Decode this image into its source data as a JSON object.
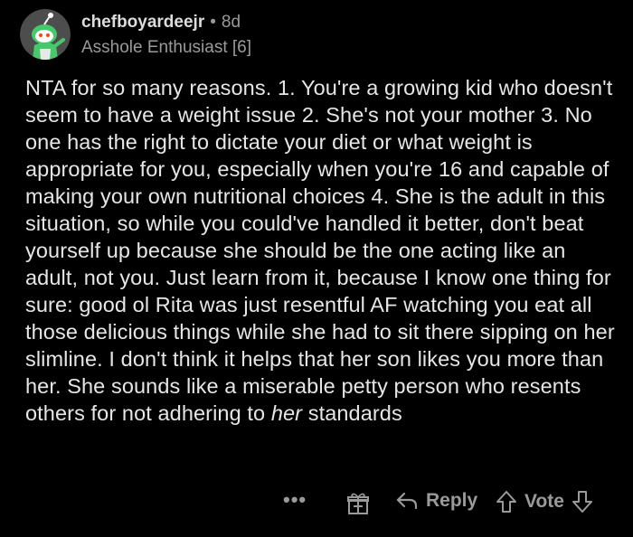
{
  "comment": {
    "username": "chefboyardeejr",
    "separator": "•",
    "age": "8d",
    "flair": "Asshole Enthusiast [6]",
    "text_before_italic": "NTA for so many reasons. 1. You're a growing kid who doesn't seem to have a weight issue 2. She's not your mother 3. No one has the right to dictate your diet or what weight is appropriate for you, especially when you're 16 and capable of making your own nutritional choices 4. She is the adult in this situation, so while you could've handled it better, don't beat yourself up because she should be the one acting like an adult, not you. Just learn from it, because I know one thing for sure: good ol Rita was just resentful AF watching you eat all those delicious things while she had to sit there sipping on her slimline. I don't think it helps that her son likes you more than her. She sounds like a miserable petty person who resents others for not adhering to ",
    "text_italic": "her",
    "text_after_italic": " standards"
  },
  "actions": {
    "more": "•••",
    "award_icon": "gift-icon",
    "reply_icon": "reply-arrow-icon",
    "reply_label": "Reply",
    "upvote_icon": "upvote-arrow-icon",
    "vote_label": "Vote",
    "downvote_icon": "downvote-arrow-icon"
  },
  "colors": {
    "background": "#000000",
    "text": "#e6e6e6",
    "muted": "#9a9a9a",
    "avatar_bg": "#5a5a5a",
    "avatar_green": "#46c96b"
  }
}
